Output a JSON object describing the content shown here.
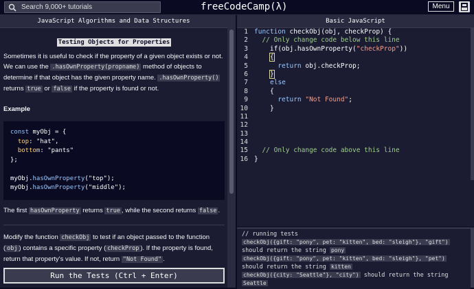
{
  "nav": {
    "search_placeholder": "Search 9,000+ tutorials",
    "logo": "freeCodeCamp(λ)",
    "menu_label": "Menu"
  },
  "left": {
    "tab_label": "JavaScript Algorithms and Data Structures",
    "title": "Testing Objects for Properties",
    "intro": {
      "t1": "Sometimes it is useful to check if the property of a given object exists or not. We can use the ",
      "c1": ".hasOwnProperty(propname)",
      "t2": " method of objects to determine if that object has the given property name. ",
      "c2": ".hasOwnProperty()",
      "t3": " returns ",
      "c3": "true",
      "t4": " or ",
      "c4": "false",
      "t5": " if the property is found or not."
    },
    "example_heading": "Example",
    "example_lines": [
      {
        "a": "const",
        "b": " myObj = {",
        "c": "",
        "d": ""
      },
      {
        "a": "",
        "b": "  ",
        "c": "top",
        "d": ": \"hat\","
      },
      {
        "a": "",
        "b": "  ",
        "c": "bottom",
        "d": ": \"pants\""
      },
      {
        "a": "",
        "b": "};",
        "c": "",
        "d": ""
      }
    ],
    "example_calls": [
      {
        "obj": "myObj.",
        "fn": "hasOwnProperty",
        "arg": "(\"top\");"
      },
      {
        "obj": "myObj.",
        "fn": "hasOwnProperty",
        "arg": "(\"middle\");"
      }
    ],
    "result": {
      "t1": "The first ",
      "c1": "hasOwnProperty",
      "t2": " returns ",
      "c2": "true",
      "t3": ", while the second returns ",
      "c3": "false",
      "t4": "."
    },
    "task": {
      "t1": "Modify the function ",
      "c1": "checkObj",
      "t2": " to test if an object passed to the function (",
      "c2": "obj",
      "t3": ") contains a specific property (",
      "c3": "checkProp",
      "t4": "). If the property is found, return that property's value. If not, return ",
      "c4": "\"Not Found\"",
      "t5": "."
    },
    "run_button": "Run the Tests (Ctrl + Enter)"
  },
  "right": {
    "tab_label": "Basic JavaScript",
    "line_numbers": [
      "1",
      "2",
      "3",
      "4",
      "5",
      "6",
      "7",
      "8",
      "9",
      "10",
      "11",
      "12",
      "13",
      "14",
      "15",
      "16"
    ],
    "code": {
      "l1a": "function",
      "l1b": " checkObj(obj, checkProp) {",
      "l2": "  // Only change code below this line",
      "l3a": "    if(obj.hasOwnProperty(",
      "l3b": "\"checkProp\"",
      "l3c": "))",
      "l4": "{",
      "l5a": "      return",
      "l5b": " obj.checkProp;",
      "l6": "}",
      "l7": "else",
      "l8": "{",
      "l9a": "      return",
      "l9b": " \"Not Found\"",
      "l9c": ";",
      "l10": "}",
      "l15": "  // Only change code above this line",
      "l16": "}"
    },
    "tests": {
      "header": "// running tests",
      "t1_call": "checkObj({gift: \"pony\", pet: \"kitten\", bed: \"sleigh\"}, \"gift\")",
      "t1_text": "should return the string",
      "t1_val": "pony",
      "t2_call": "checkObj({gift: \"pony\", pet: \"kitten\", bed: \"sleigh\"}, \"pet\")",
      "t2_text": "should return the string",
      "t2_val": "kitten",
      "t3_call": "checkObj({city: \"Seattle\"}, \"city\")",
      "t3_text": "should return the string",
      "t3_val": "Seattle"
    }
  }
}
